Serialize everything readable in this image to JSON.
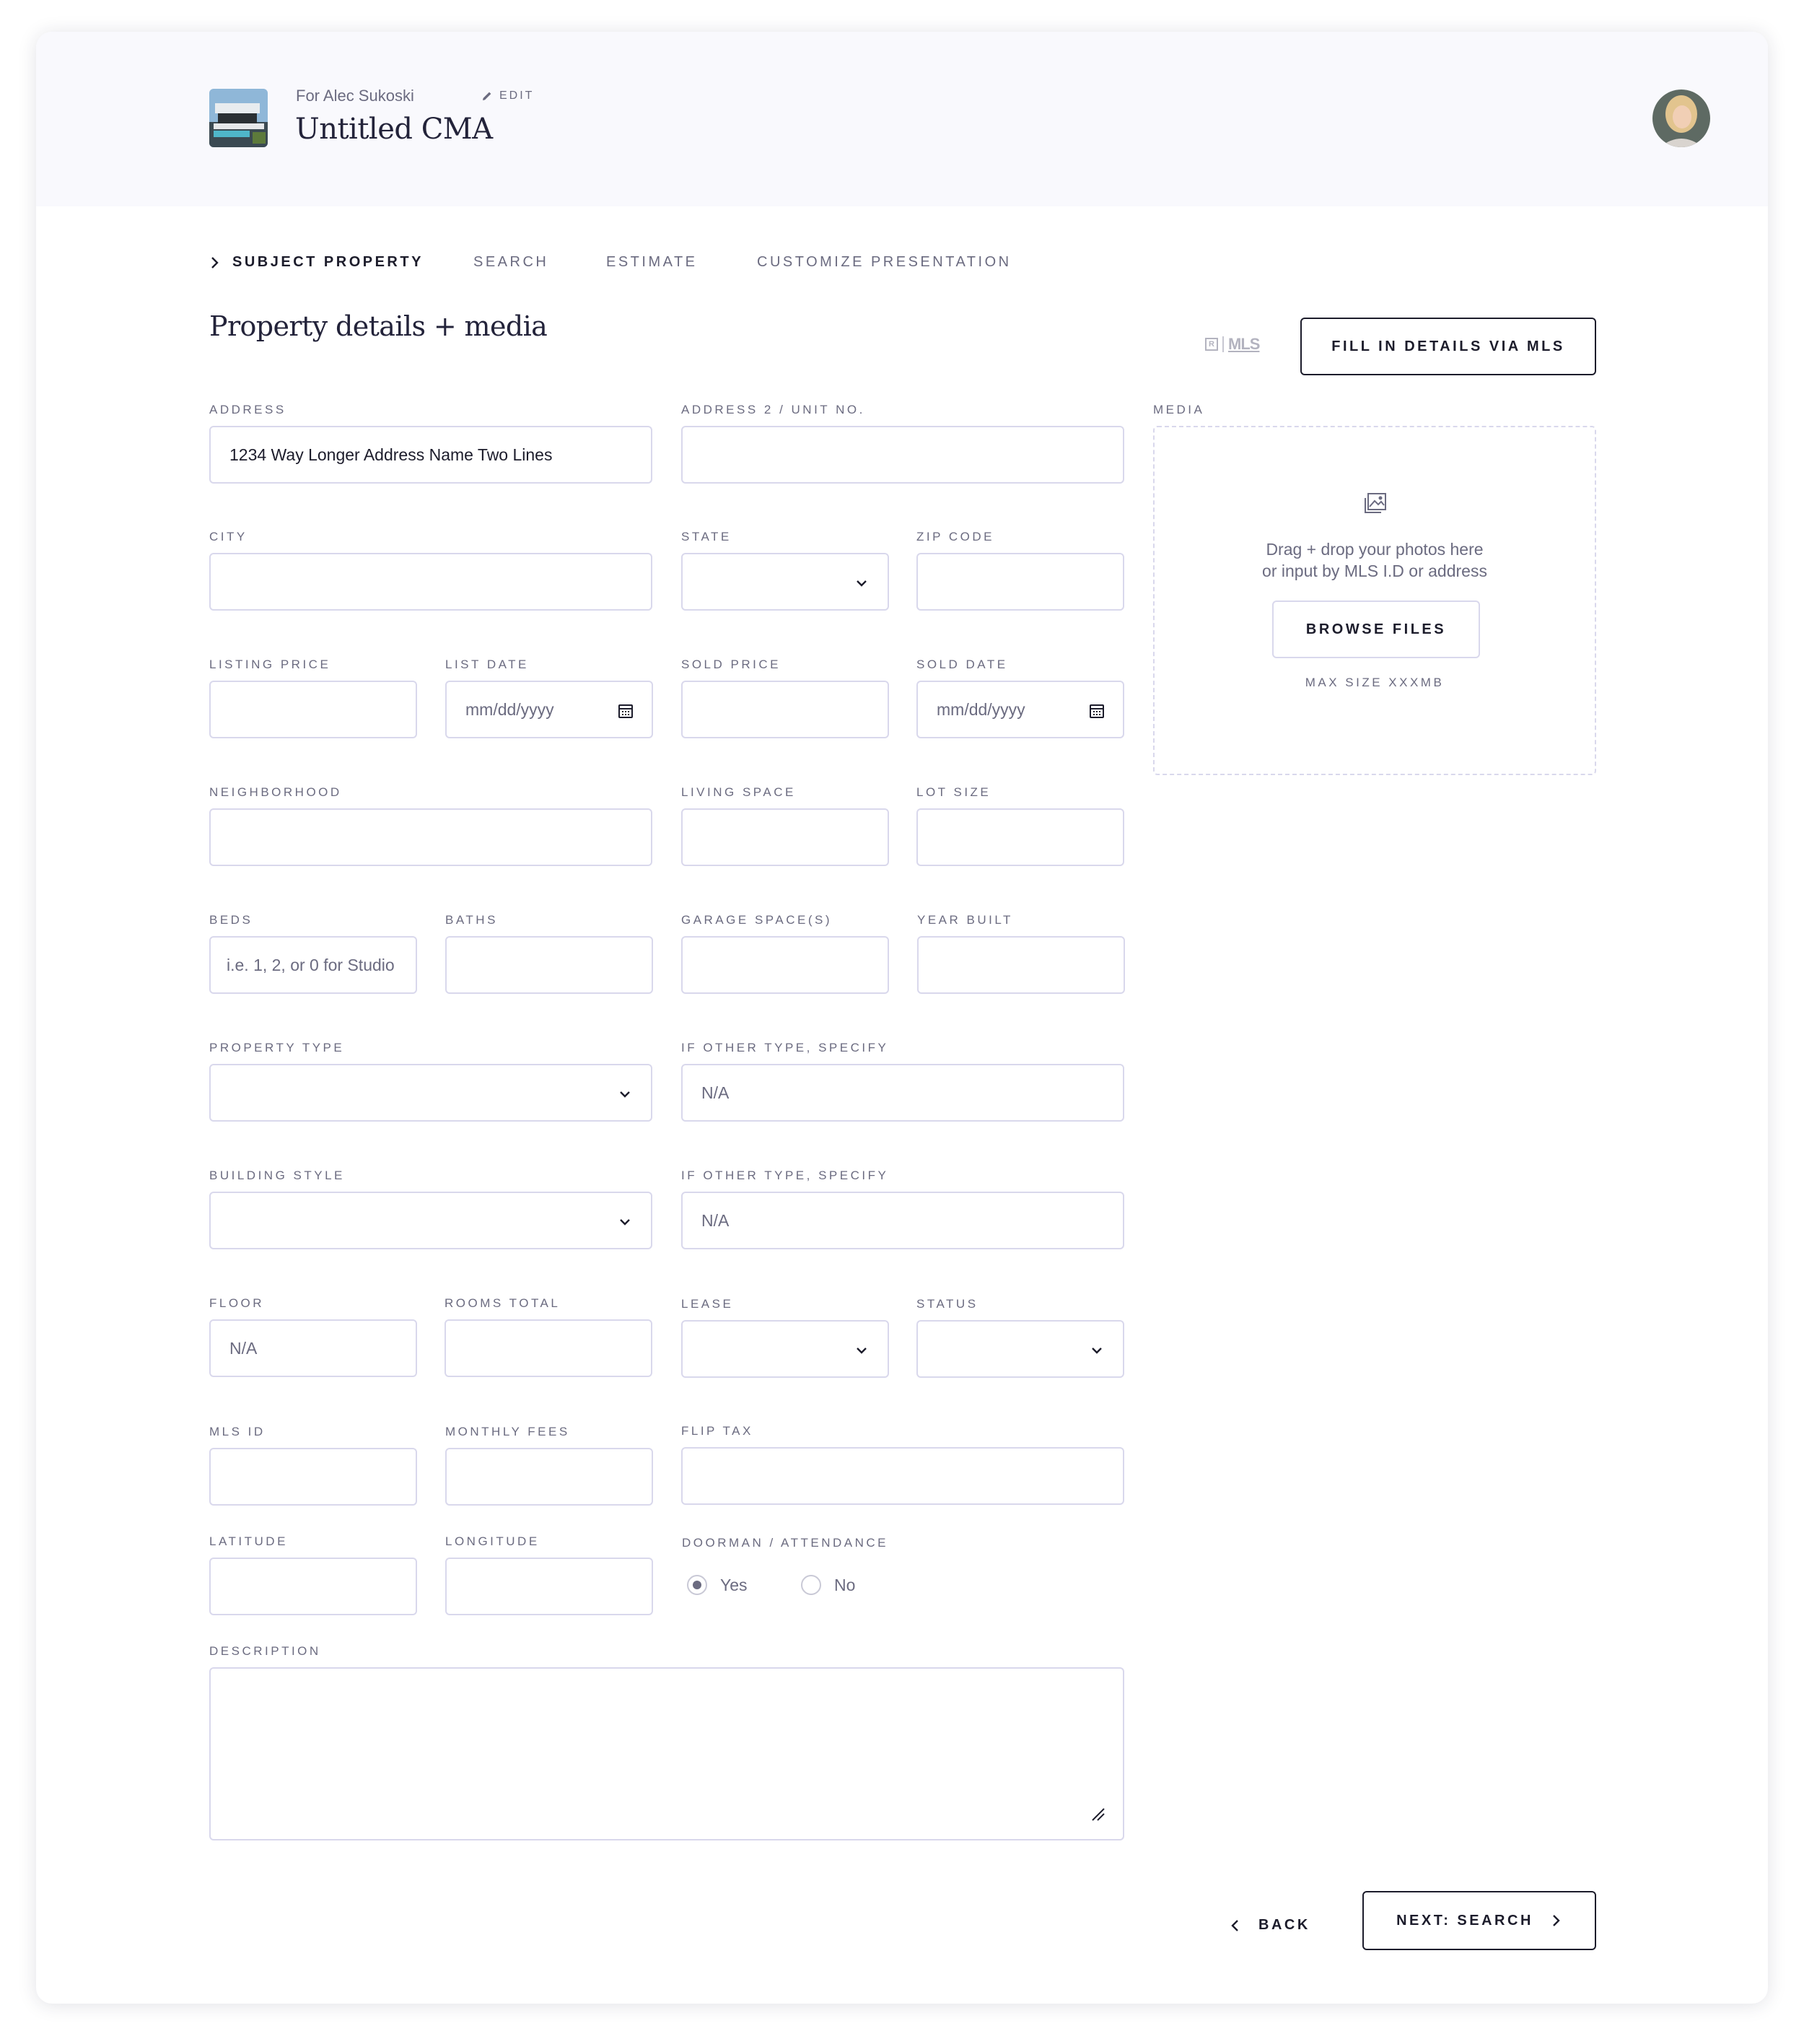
{
  "header": {
    "for_line": "For Alec Sukoski",
    "edit_label": "EDIT",
    "title": "Untitled CMA"
  },
  "tabs": [
    {
      "label": "SUBJECT PROPERTY",
      "active": true
    },
    {
      "label": "SEARCH",
      "active": false
    },
    {
      "label": "ESTIMATE",
      "active": false
    },
    {
      "label": "CUSTOMIZE PRESENTATION",
      "active": false
    }
  ],
  "section": {
    "title": "Property details + media",
    "mls_logo": "MLS",
    "fill_mls_button": "FILL IN DETAILS VIA MLS"
  },
  "form": {
    "address": {
      "label": "ADDRESS",
      "value": "1234 Way Longer Address Name Two Lines"
    },
    "address2": {
      "label": "ADDRESS 2 / UNIT NO.",
      "value": ""
    },
    "city": {
      "label": "CITY",
      "value": ""
    },
    "state": {
      "label": "STATE",
      "value": ""
    },
    "zip": {
      "label": "ZIP CODE",
      "value": ""
    },
    "listing_price": {
      "label": "LISTING PRICE",
      "value": ""
    },
    "list_date": {
      "label": "LIST DATE",
      "placeholder": "mm/dd/yyyy"
    },
    "sold_price": {
      "label": "SOLD PRICE",
      "value": ""
    },
    "sold_date": {
      "label": "SOLD DATE",
      "placeholder": "mm/dd/yyyy"
    },
    "neighborhood": {
      "label": "NEIGHBORHOOD",
      "value": ""
    },
    "living_space": {
      "label": "LIVING SPACE",
      "value": ""
    },
    "lot_size": {
      "label": "LOT SIZE",
      "value": ""
    },
    "beds": {
      "label": "BEDS",
      "placeholder": "i.e. 1, 2, or 0 for Studio"
    },
    "baths": {
      "label": "BATHS",
      "value": ""
    },
    "garage": {
      "label": "GARAGE SPACE(S)",
      "value": ""
    },
    "year_built": {
      "label": "YEAR BUILT",
      "value": ""
    },
    "property_type": {
      "label": "PROPERTY TYPE",
      "value": ""
    },
    "other_type_1": {
      "label": "IF OTHER TYPE, SPECIFY",
      "placeholder": "N/A"
    },
    "building_style": {
      "label": "BUILDING STYLE",
      "value": ""
    },
    "other_type_2": {
      "label": "IF OTHER TYPE, SPECIFY",
      "placeholder": "N/A"
    },
    "floor": {
      "label": "FLOOR",
      "placeholder": "N/A"
    },
    "rooms_total": {
      "label": "ROOMS TOTAL",
      "value": ""
    },
    "lease": {
      "label": "LEASE",
      "value": ""
    },
    "status": {
      "label": "STATUS",
      "value": ""
    },
    "mls_id": {
      "label": "MLS ID",
      "value": ""
    },
    "monthly_fees": {
      "label": "MONTHLY FEES",
      "value": ""
    },
    "flip_tax": {
      "label": "FLIP TAX",
      "value": ""
    },
    "latitude": {
      "label": "LATITUDE",
      "value": ""
    },
    "longitude": {
      "label": "LONGITUDE",
      "value": ""
    },
    "doorman": {
      "label": "DOORMAN / ATTENDANCE",
      "options": [
        "Yes",
        "No"
      ],
      "selected": "Yes"
    },
    "description": {
      "label": "DESCRIPTION",
      "value": ""
    }
  },
  "media": {
    "label": "MEDIA",
    "drop_line1": "Drag + drop your photos here",
    "drop_line2": "or input by MLS I.D or address",
    "browse_button": "BROWSE FILES",
    "max_size": "MAX SIZE XXXMB"
  },
  "footer": {
    "back_label": "BACK",
    "next_label": "NEXT: SEARCH"
  },
  "colors": {
    "accent": "#1c1c2b",
    "muted_text": "#6b6b80",
    "field_border": "#d9d8ec",
    "header_bg": "#f9f9fd"
  }
}
